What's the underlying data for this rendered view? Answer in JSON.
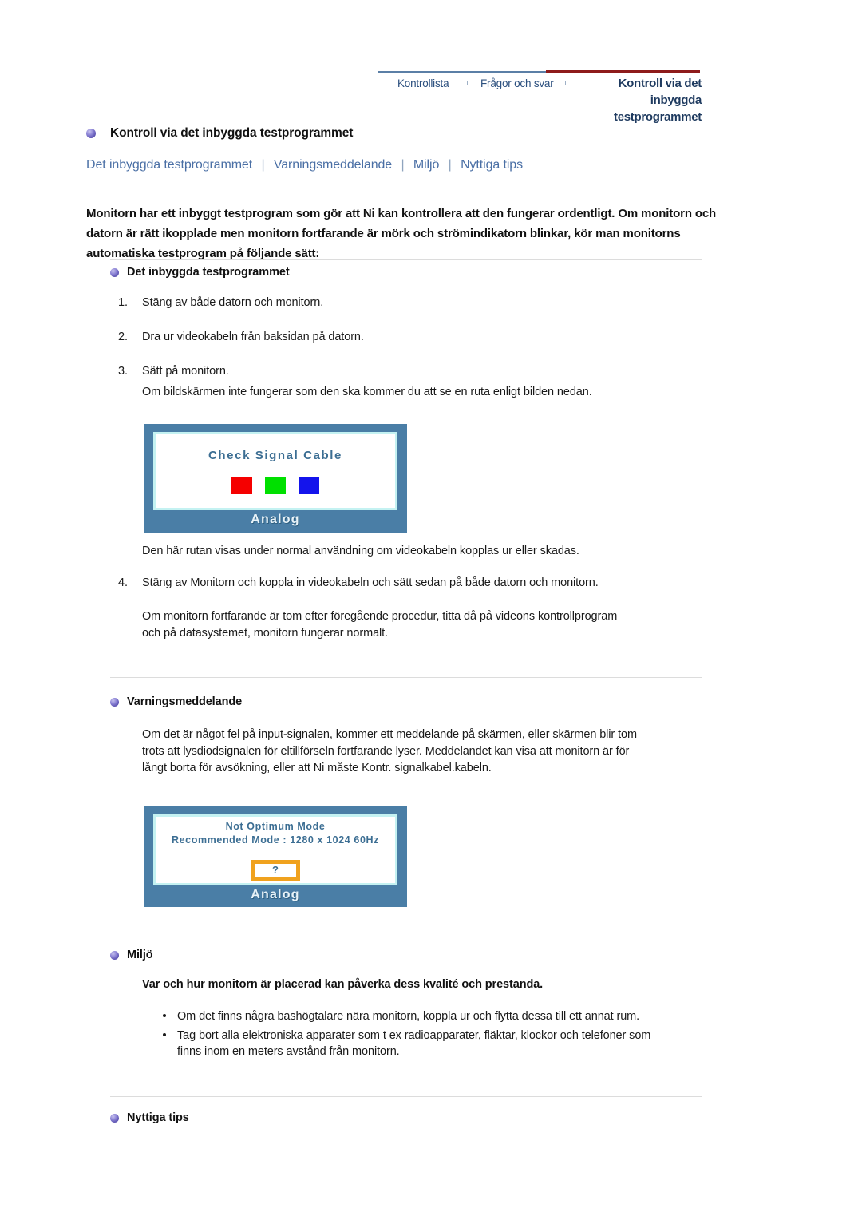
{
  "topnav": {
    "items": [
      {
        "label": "Kontrollista"
      },
      {
        "label": "Frågor och svar"
      }
    ],
    "separator": "ı",
    "current": "Kontroll via det inbyggda testprogrammet",
    "rule_blue_color": "#5b7fa6",
    "rule_red_color": "#8e1b1b"
  },
  "page": {
    "title": "Kontroll via det inbyggda testprogrammet",
    "subnav": [
      {
        "label": "Det inbyggda testprogrammet"
      },
      {
        "label": "Varningsmeddelande"
      },
      {
        "label": "Miljö"
      },
      {
        "label": "Nyttiga tips"
      }
    ],
    "subnav_separator": "|",
    "intro": "Monitorn har ett inbyggt testprogram som gör att Ni kan kontrollera att den fungerar ordentligt. Om monitorn och datorn är rätt ikopplade men monitorn fortfarande är mörk och strömindikatorn blinkar, kör man monitorns automatiska testprogram på följande sätt:"
  },
  "section_builtin": {
    "heading": "Det inbyggda testprogrammet",
    "steps": [
      {
        "num": "1.",
        "text": "Stäng av både datorn och monitorn."
      },
      {
        "num": "2.",
        "text": "Dra ur videokabeln från baksidan på datorn."
      },
      {
        "num": "3.",
        "text": "Sätt på monitorn."
      }
    ],
    "after_step3": "Om bildskärmen inte fungerar som den ska kommer du att se en ruta enligt bilden nedan.",
    "caption": "Den här rutan visas under normal användning om videokabeln kopplas ur eller skadas.",
    "step4": {
      "num": "4.",
      "text": "Stäng av Monitorn och koppla in videokabeln och sätt sedan på både datorn och monitorn."
    },
    "closing": "Om monitorn fortfarande är tom efter föregående procedur, titta då på videons kontrollprogram och på datasystemet, monitorn fungerar normalt."
  },
  "monitor_check": {
    "osd_title": "Check Signal Cable",
    "label": "Analog",
    "swatches": [
      {
        "name": "red-swatch",
        "color": "#f50000"
      },
      {
        "name": "green-swatch",
        "color": "#00e000"
      },
      {
        "name": "blue-swatch",
        "color": "#1414ec"
      }
    ],
    "frame_color": "#4a7ea6",
    "inner_border_color": "#c4f2f2"
  },
  "section_warning": {
    "heading": "Varningsmeddelande",
    "body": "Om det är något fel på input-signalen, kommer ett meddelande på skärmen, eller skärmen blir tom trots att lysdiodsignalen för eltillförseln fortfarande lyser. Meddelandet kan visa att monitorn är för långt borta för avsökning, eller att Ni måste Kontr. signalkabel.kabeln."
  },
  "monitor_mode": {
    "line1": "Not Optimum Mode",
    "line2": "Recommended Mode : 1280 x 1024  60Hz",
    "question_mark": "?",
    "label": "Analog",
    "box_border_color": "#f0a21e"
  },
  "section_environment": {
    "heading": "Miljö",
    "lead": "Var och hur monitorn är placerad kan påverka dess kvalité och prestanda.",
    "bullets": [
      {
        "text": "Om det finns några bashögtalare nära monitorn, koppla ur och flytta dessa till ett annat rum."
      },
      {
        "text": "Tag bort alla elektroniska apparater som t ex radioapparater, fläktar, klockor och telefoner som finns inom en meters avstånd från monitorn."
      }
    ]
  },
  "section_tips": {
    "heading": "Nyttiga tips"
  }
}
